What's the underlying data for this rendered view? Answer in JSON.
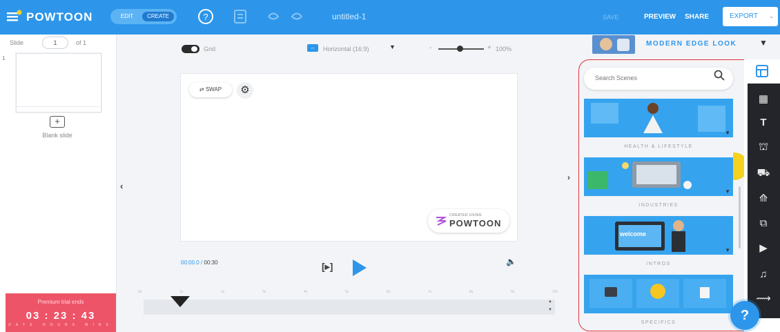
{
  "topbar": {
    "brand": "POWTOON",
    "mode_edit": "EDIT",
    "mode_create": "CREATE",
    "doc_title": "untitled-1",
    "save_label": "SAVE",
    "preview_label": "PREVIEW",
    "share_label": "SHARE",
    "export_label": "EXPORT",
    "icons": [
      "help-circle-icon",
      "slides-icon",
      "undo-icon",
      "redo-icon"
    ]
  },
  "left_panel": {
    "slide_prefix": "Slide",
    "slide_number": "1",
    "slide_of": "of 1",
    "slide_index_label": "1",
    "blank_slide_label": "Blank slide",
    "trial_title": "Premium trial ends",
    "trial_time": "03 : 23 : 43",
    "trial_units": "DAYS HOURS MINS"
  },
  "canvas_toolbar": {
    "grid_label": "Grid",
    "aspect_label": "Horizontal (16:9)",
    "zoom_value": "100%"
  },
  "stage": {
    "swap_label": "⇄ SWAP",
    "watermark_small": "CREATED USING",
    "watermark_brand": "POWTOON"
  },
  "playback": {
    "time_current": "00:00.0",
    "time_separator": "/",
    "time_total": "00:30",
    "ruler_ticks": [
      "0s",
      "1s",
      "2s",
      "3s",
      "4s",
      "5s",
      "6s",
      "7s",
      "8s",
      "9s",
      "10s"
    ]
  },
  "library": {
    "style_label": "MODERN EDGE LOOK",
    "search_placeholder": "Search Scenes",
    "categories": [
      {
        "label": "HEALTH & LIFESTYLE"
      },
      {
        "label": "INDUSTRIES"
      },
      {
        "label": "INTROS",
        "card_text": "welcome"
      },
      {
        "label": "SPECIFICS"
      }
    ]
  },
  "toolbar_right": {
    "tools": [
      "scenes-icon",
      "backgrounds-icon",
      "text-icon",
      "characters-icon",
      "props-icon",
      "shapes-icon",
      "media-icon",
      "video-icon",
      "music-icon",
      "transitions-icon"
    ]
  },
  "help_label": "?",
  "colors": {
    "brand_blue": "#2d96ea",
    "trial_red": "#ee5468",
    "toolbar_dark": "#23252a",
    "annotation_red": "#e03234"
  }
}
